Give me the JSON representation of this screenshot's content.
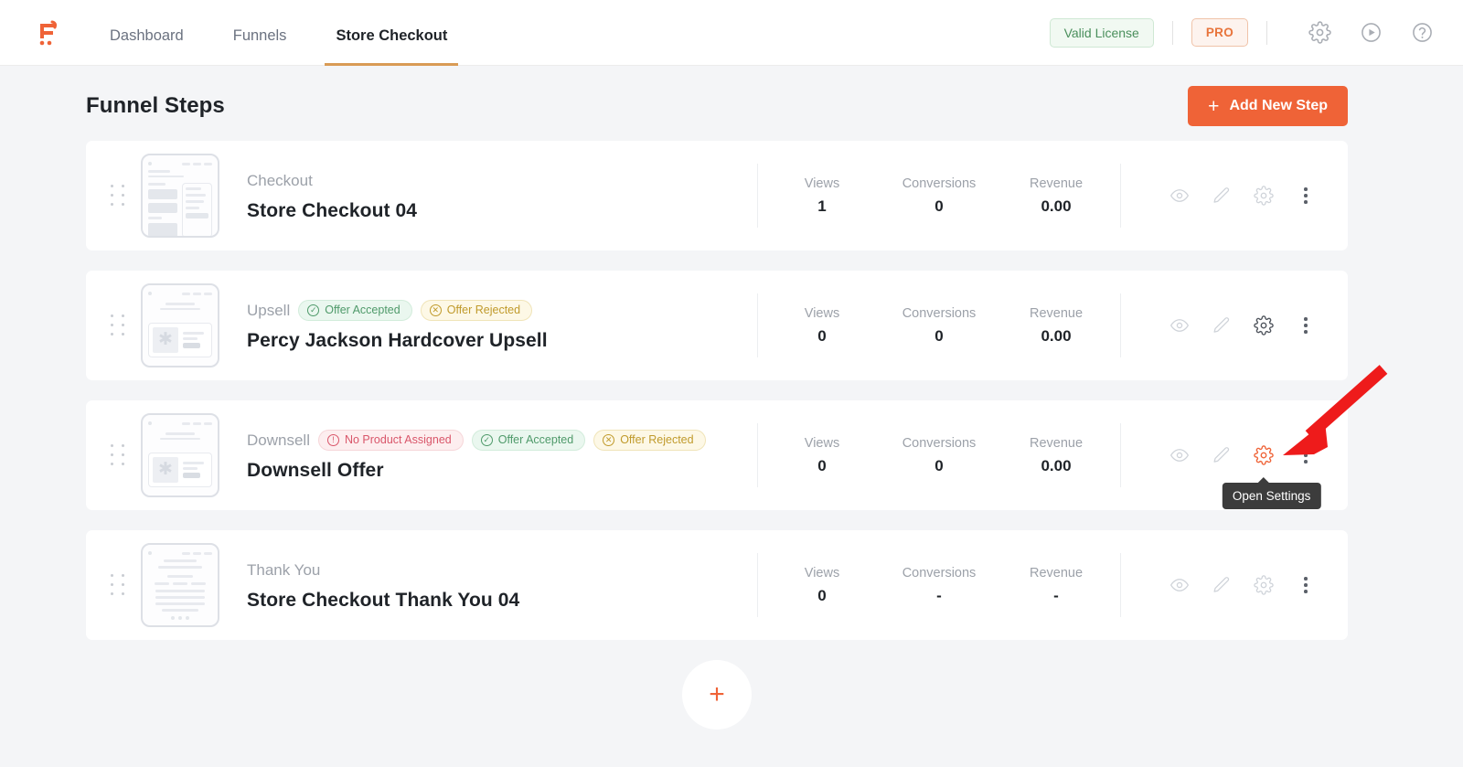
{
  "header": {
    "logo_icon": "funnel-cart-logo-icon",
    "nav": [
      {
        "label": "Dashboard",
        "active": false
      },
      {
        "label": "Funnels",
        "active": false
      },
      {
        "label": "Store Checkout",
        "active": true
      }
    ],
    "license_label": "Valid License",
    "pro_label": "PRO",
    "icons": [
      {
        "name": "gear-icon",
        "glyph": "settings"
      },
      {
        "name": "play-circle-icon",
        "glyph": "play"
      },
      {
        "name": "help-circle-icon",
        "glyph": "help"
      }
    ]
  },
  "page": {
    "title": "Funnel Steps",
    "add_step_label": "Add New Step",
    "add_step_plus": "+",
    "add_circle_plus": "+"
  },
  "stat_labels": {
    "views": "Views",
    "conversions": "Conversions",
    "revenue": "Revenue"
  },
  "tooltip": {
    "text": "Open Settings"
  },
  "colors": {
    "brand_orange": "#ef6337",
    "accent_underline": "#d99b55",
    "badge_green": "#4f9a6a",
    "badge_yellow": "#c09a2b",
    "badge_red": "#d9566a",
    "annotation_arrow_red": "#ee1b1b",
    "page_bg": "#f4f5f7",
    "card_bg": "#ffffff"
  },
  "steps": [
    {
      "type": "Checkout",
      "name": "Store Checkout 04",
      "thumb": "checkout-page-thumbnail",
      "badges": [],
      "views": "1",
      "conversions": "0",
      "revenue": "0.00",
      "gear_highlight": "none",
      "tooltip_visible": false
    },
    {
      "type": "Upsell",
      "name": "Percy Jackson Hardcover Upsell",
      "thumb": "offer-page-thumbnail",
      "badges": [
        {
          "label": "Offer Accepted",
          "style": "green",
          "icon": "check-circle-icon",
          "glyph": "✓"
        },
        {
          "label": "Offer Rejected",
          "style": "yellow",
          "icon": "x-circle-icon",
          "glyph": "✕"
        }
      ],
      "views": "0",
      "conversions": "0",
      "revenue": "0.00",
      "gear_highlight": "dark",
      "tooltip_visible": false
    },
    {
      "type": "Downsell",
      "name": "Downsell Offer",
      "thumb": "offer-page-thumbnail",
      "badges": [
        {
          "label": "No Product Assigned",
          "style": "red",
          "icon": "alert-circle-icon",
          "glyph": "!"
        },
        {
          "label": "Offer Accepted",
          "style": "green",
          "icon": "check-circle-icon",
          "glyph": "✓"
        },
        {
          "label": "Offer Rejected",
          "style": "yellow",
          "icon": "x-circle-icon",
          "glyph": "✕"
        }
      ],
      "views": "0",
      "conversions": "0",
      "revenue": "0.00",
      "gear_highlight": "orange",
      "tooltip_visible": true
    },
    {
      "type": "Thank You",
      "name": "Store Checkout Thank You 04",
      "thumb": "thankyou-page-thumbnail",
      "badges": [],
      "views": "0",
      "conversions": "-",
      "revenue": "-",
      "gear_highlight": "none",
      "tooltip_visible": false
    }
  ],
  "row_actions": [
    {
      "name": "preview-icon",
      "title": "Preview"
    },
    {
      "name": "edit-pencil-icon",
      "title": "Edit"
    },
    {
      "name": "settings-gear-icon",
      "title": "Open Settings"
    },
    {
      "name": "more-options-icon",
      "title": "More"
    }
  ]
}
